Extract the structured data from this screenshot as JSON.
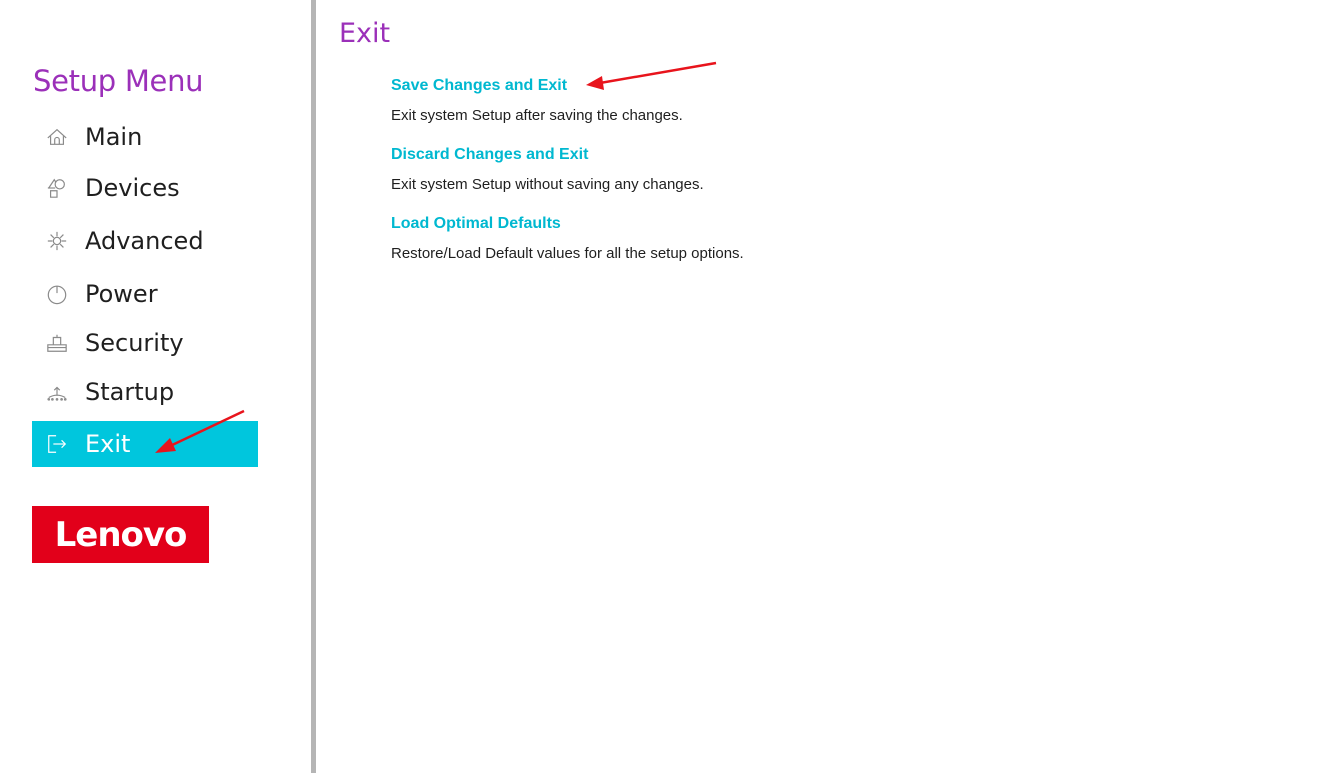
{
  "sidebar": {
    "title": "Setup Menu",
    "items": [
      {
        "label": "Main",
        "icon": "home-icon"
      },
      {
        "label": "Devices",
        "icon": "devices-icon"
      },
      {
        "label": "Advanced",
        "icon": "advanced-icon"
      },
      {
        "label": "Power",
        "icon": "power-icon"
      },
      {
        "label": "Security",
        "icon": "security-icon"
      },
      {
        "label": "Startup",
        "icon": "startup-icon"
      },
      {
        "label": "Exit",
        "icon": "exit-icon",
        "selected": true
      }
    ],
    "logo_text": "Lenovo"
  },
  "main": {
    "title": "Exit",
    "options": [
      {
        "title": "Save Changes and Exit",
        "description": "Exit system Setup after saving the changes."
      },
      {
        "title": "Discard Changes and Exit",
        "description": "Exit system Setup without saving any changes."
      },
      {
        "title": "Load Optimal Defaults",
        "description": "Restore/Load Default values for all the setup options."
      }
    ]
  },
  "colors": {
    "accent_purple": "#9b30b9",
    "selection_cyan": "#00c6dd",
    "option_cyan": "#00b8d0",
    "lenovo_red": "#e2001a",
    "annotation_red": "#e8141c"
  }
}
